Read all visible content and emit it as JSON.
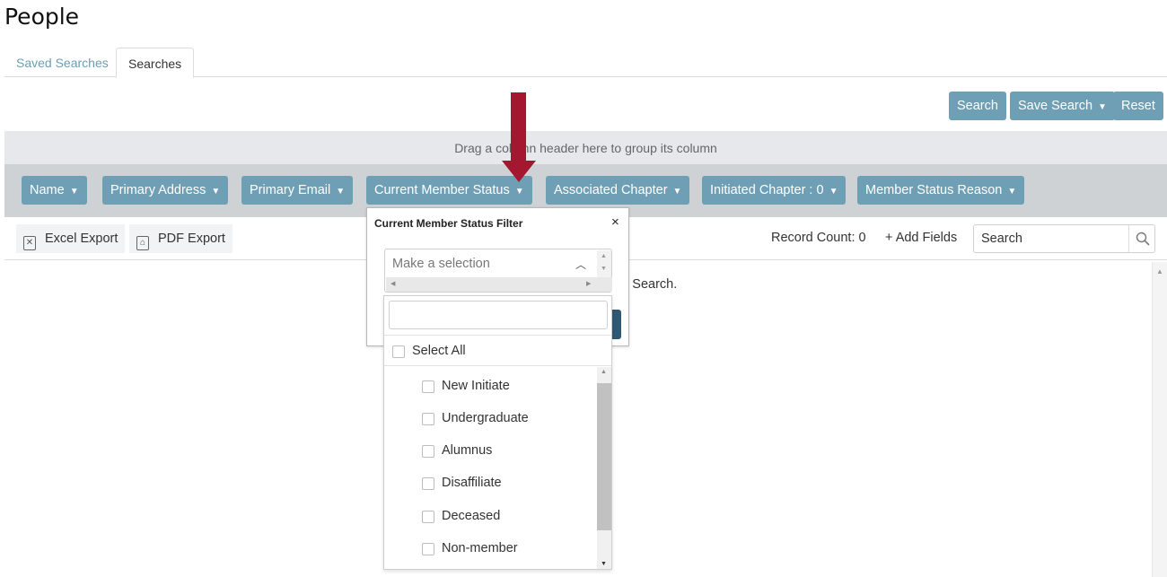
{
  "page": {
    "title": "People"
  },
  "tabs": [
    {
      "label": "Saved Searches",
      "active": false
    },
    {
      "label": "Searches",
      "active": true
    }
  ],
  "actions": {
    "search_label": "Search",
    "save_search_label": "Save Search",
    "reset_label": "Reset"
  },
  "grid": {
    "group_hint": "Drag a column header here to group its column",
    "columns": [
      "Name",
      "Primary Address",
      "Primary Email",
      "Current Member Status",
      "Associated Chapter",
      "Initiated Chapter : 0",
      "Member Status Reason"
    ],
    "no_data_fragment": "ct Search."
  },
  "toolbar": {
    "excel_export": "Excel Export",
    "pdf_export": "PDF Export",
    "record_count": "Record Count: 0",
    "add_fields": "+ Add Fields",
    "search_value": "Search"
  },
  "filter_popup": {
    "title": "Current Member Status Filter",
    "close": "×",
    "placeholder": "Make a selection",
    "select_all": "Select All",
    "options": [
      "New Initiate",
      "Undergraduate",
      "Alumnus",
      "Disaffiliate",
      "Deceased",
      "Non-member"
    ]
  },
  "colors": {
    "button": "#6f9fb4",
    "arrow": "#a31830",
    "group_bar": "#e6e8eb",
    "header_bar": "#cfd2d5"
  }
}
